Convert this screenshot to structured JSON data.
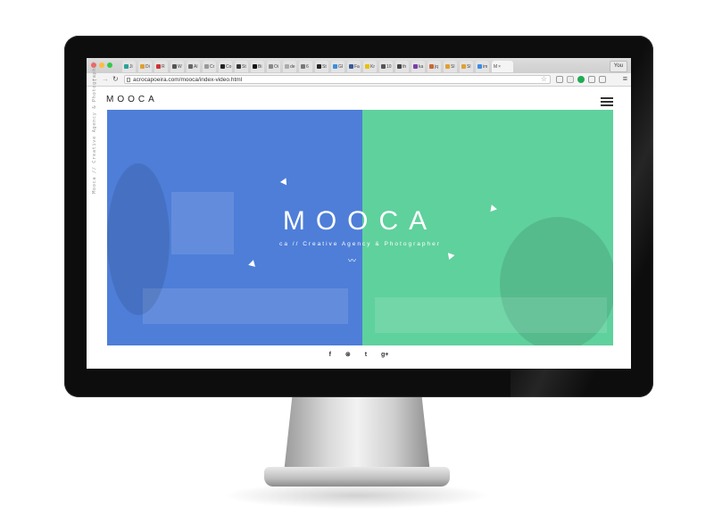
{
  "browser": {
    "tabs": [
      {
        "label": "Ji",
        "color": "#2aa198"
      },
      {
        "label": "Di",
        "color": "#e0a030"
      },
      {
        "label": "R",
        "color": "#cc3333"
      },
      {
        "label": "W",
        "color": "#555555"
      },
      {
        "label": "Al",
        "color": "#666666"
      },
      {
        "label": "Cr",
        "color": "#999999"
      },
      {
        "label": "Co",
        "color": "#222222"
      },
      {
        "label": "St",
        "color": "#333333"
      },
      {
        "label": "Bi",
        "color": "#111111"
      },
      {
        "label": "Oi",
        "color": "#888888"
      },
      {
        "label": "de",
        "color": "#aaaaaa"
      },
      {
        "label": "6",
        "color": "#777777"
      },
      {
        "label": "St",
        "color": "#222222"
      },
      {
        "label": "Gl",
        "color": "#3b8de0"
      },
      {
        "label": "Fa",
        "color": "#3b5998"
      },
      {
        "label": "Kr",
        "color": "#e8c000"
      },
      {
        "label": "10",
        "color": "#555555"
      },
      {
        "label": "th",
        "color": "#444444"
      },
      {
        "label": "ka",
        "color": "#7a3ea8"
      },
      {
        "label": "jq",
        "color": "#cc6633"
      },
      {
        "label": "Sl",
        "color": "#e0a030"
      },
      {
        "label": "Sl",
        "color": "#e0a030"
      },
      {
        "label": "im",
        "color": "#3b8de0"
      }
    ],
    "active_tab": {
      "label": "M",
      "close": "×"
    },
    "profile": "You",
    "url": "acrocapoeira.com/mooca/index-video.html",
    "icons": {
      "back": "back-arrow-icon",
      "forward": "forward-arrow-icon",
      "reload": "reload-icon",
      "star": "star-icon",
      "menu": "menu-icon"
    }
  },
  "page": {
    "logo": "MOOCA",
    "side_text": "Mooca // Creative Agency & Photographer",
    "hero_title": "MOOCA",
    "hero_subtitle": "ca // Creative Agency & Photographer",
    "colors": {
      "blue": "#4e7ed8",
      "green": "#5fd19d"
    },
    "socials": [
      "f",
      "⊗",
      "t",
      "g+"
    ]
  }
}
